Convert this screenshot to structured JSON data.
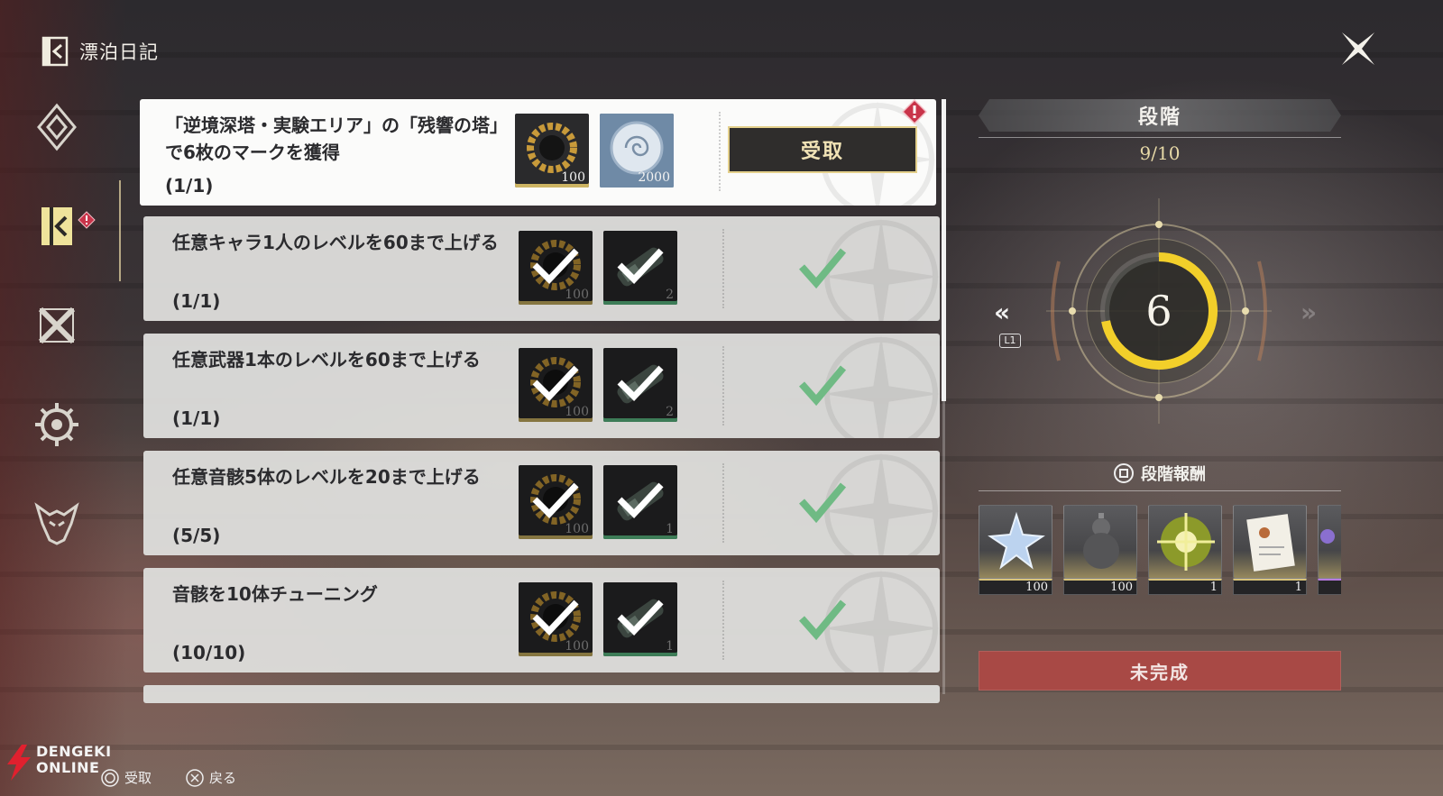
{
  "app": {
    "title": "漂泊日記",
    "close_icon": "close-x-icon"
  },
  "nav": {
    "items": [
      {
        "icon": "diamond-rank-icon",
        "active": false
      },
      {
        "icon": "journal-icon",
        "active": true,
        "alert": true
      },
      {
        "icon": "crossed-swords-icon",
        "active": false
      },
      {
        "icon": "gear-wheel-icon",
        "active": false
      },
      {
        "icon": "monster-head-icon",
        "active": false
      }
    ]
  },
  "quests": [
    {
      "text": "「逆境深塔・実験エリア」の「残響の塔」で6枚のマークを獲得",
      "progress": "(1/1)",
      "state": "claimable",
      "claim_label": "受取",
      "rewards": [
        {
          "icon": "gold-ring-icon",
          "qty": "100",
          "rarity": "gold"
        },
        {
          "icon": "spiral-coin-icon",
          "qty": "2000",
          "rarity": "blue"
        }
      ]
    },
    {
      "text": "任意キャラ1人のレベルを60まで上げる",
      "progress": "(1/1)",
      "state": "done",
      "rewards": [
        {
          "icon": "gold-ring-icon",
          "qty": "100",
          "rarity": "gold"
        },
        {
          "icon": "tube-capsule-icon",
          "qty": "2",
          "rarity": "green"
        }
      ]
    },
    {
      "text": "任意武器1本のレベルを60まで上げる",
      "progress": "(1/1)",
      "state": "done",
      "rewards": [
        {
          "icon": "gold-ring-icon",
          "qty": "100",
          "rarity": "gold"
        },
        {
          "icon": "tube-capsule-icon",
          "qty": "2",
          "rarity": "green"
        }
      ]
    },
    {
      "text": "任意音骸5体のレベルを20まで上げる",
      "progress": "(5/5)",
      "state": "done",
      "rewards": [
        {
          "icon": "gold-ring-icon",
          "qty": "100",
          "rarity": "gold"
        },
        {
          "icon": "tube-capsule-icon",
          "qty": "1",
          "rarity": "green"
        }
      ]
    },
    {
      "text": "音骸を10体チューニング",
      "progress": "(10/10)",
      "state": "done",
      "rewards": [
        {
          "icon": "gold-ring-icon",
          "qty": "100",
          "rarity": "gold"
        },
        {
          "icon": "tube-capsule-icon",
          "qty": "1",
          "rarity": "green"
        }
      ]
    }
  ],
  "stage": {
    "title": "段階",
    "count": "9/10",
    "current": "6",
    "progress_fraction": 0.72,
    "prev_hint": "L1",
    "rewards_label": "段階報酬",
    "rewards": [
      {
        "icon": "crystal-star-icon",
        "qty": "100"
      },
      {
        "icon": "gourd-icon",
        "qty": "100"
      },
      {
        "icon": "golden-orb-icon",
        "qty": "1"
      },
      {
        "icon": "recipe-scroll-icon",
        "qty": "1"
      },
      {
        "icon": "purple-item-icon",
        "qty": ""
      }
    ],
    "status_label": "未完成"
  },
  "footer": {
    "hints": [
      {
        "glyph": "circle-button-icon",
        "label": "受取"
      },
      {
        "glyph": "cross-button-icon",
        "label": "戻る"
      }
    ],
    "watermark_line1": "DENGEKI",
    "watermark_line2": "ONLINE"
  },
  "colors": {
    "accent_gold": "#e4d08c",
    "incomplete_red": "#a84945",
    "check_green": "#6fba84"
  }
}
